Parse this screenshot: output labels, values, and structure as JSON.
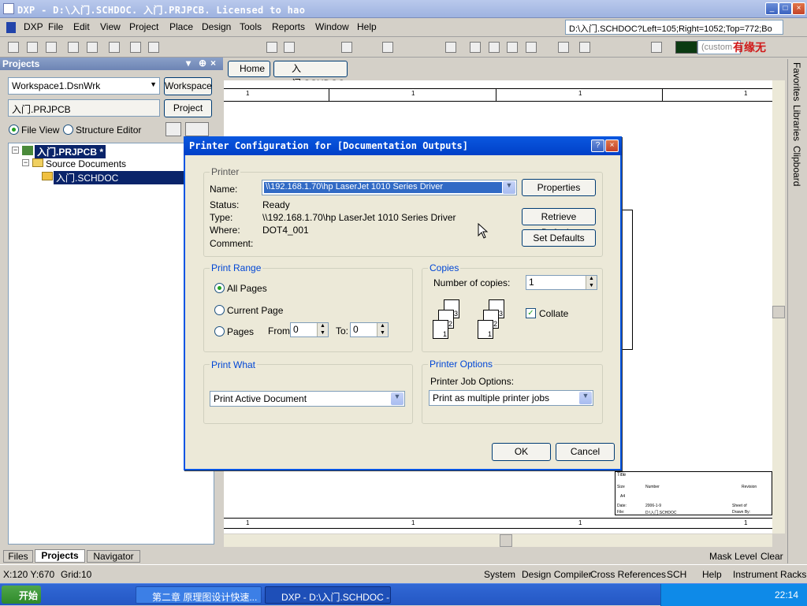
{
  "window": {
    "title": "DXP - D:\\入门.SCHDOC. 入门.PRJPCB. Licensed to hao",
    "controls": [
      "_",
      "□",
      "×"
    ]
  },
  "menu": [
    "DXP",
    "File",
    "Edit",
    "View",
    "Project",
    "Place",
    "Design",
    "Tools",
    "Reports",
    "Window",
    "Help"
  ],
  "address_combo": "D:\\入门.SCHDOC?Left=105;Right=1052;Top=772;Bo",
  "custom_combo": "(custom",
  "logo_text": "有缘无",
  "projects_panel": {
    "title": "Projects",
    "workspace_field": "Workspace1.DsnWrk",
    "workspace_button": "Workspace",
    "project_field": "入门.PRJPCB",
    "project_button": "Project",
    "file_view": "File View",
    "structure_editor": "Structure Editor",
    "tree": {
      "project": "入门.PRJPCB *",
      "folder": "Source Documents",
      "document": "入门.SCHDOC"
    },
    "tabs": [
      "Files",
      "Projects",
      "Navigator"
    ]
  },
  "doc_tabs": [
    "Home",
    "入门.SCHDOC"
  ],
  "right_panels": [
    "Favorites",
    "Libraries",
    "Clipboard"
  ],
  "ruler_marks": [
    "1",
    "1",
    "1",
    "1",
    "1",
    "1",
    "1",
    "1"
  ],
  "title_block": {
    "title": "Title",
    "size": "Size",
    "number": "Number",
    "rev": "Revision",
    "size_val": "A4",
    "date_label": "Date:",
    "date_val": "2006-1-9",
    "sheet": "Sheet   of",
    "file_label": "File:",
    "file_val": "D:\\入门.SCHDOC",
    "drawn": "Drawn By:"
  },
  "dialog": {
    "title": "Printer Configuration for [Documentation Outputs]",
    "printer_group": "Printer",
    "name_label": "Name:",
    "name_value": "\\\\192.168.1.70\\hp LaserJet 1010 Series Driver",
    "status_label": "Status:",
    "status_value": "Ready",
    "type_label": "Type:",
    "type_value": "\\\\192.168.1.70\\hp LaserJet 1010 Series Driver",
    "where_label": "Where:",
    "where_value": "DOT4_001",
    "comment_label": "Comment:",
    "properties_btn": "Properties",
    "retrieve_btn": "Retrieve Defaults",
    "setdefaults_btn": "Set Defaults",
    "range_group": "Print Range",
    "all_pages": "All Pages",
    "current_page": "Current Page",
    "pages": "Pages",
    "from_label": "From:",
    "from_value": "0",
    "to_label": "To:",
    "to_value": "0",
    "copies_group": "Copies",
    "num_copies_label": "Number of copies:",
    "num_copies_value": "1",
    "collate": "Collate",
    "page_labels": [
      "3",
      "2",
      "1",
      "3",
      "2",
      "1"
    ],
    "what_group": "Print What",
    "what_value": "Print Active Document",
    "options_group": "Printer Options",
    "job_options_label": "Printer Job Options:",
    "job_options_value": "Print as multiple printer jobs",
    "ok": "OK",
    "cancel": "Cancel"
  },
  "doc_bottom": {
    "mask_level": "Mask Level",
    "clear": "Clear"
  },
  "status": {
    "coords": "X:120 Y:670",
    "grid": "Grid:10",
    "items": [
      "System",
      "Design Compiler",
      "Cross References",
      "SCH",
      "Help",
      "Instrument Racks"
    ]
  },
  "taskbar": {
    "start": "开始",
    "tasks": [
      "第二章 原理图设计快速...",
      "DXP - D:\\入门.SCHDOC - ..."
    ],
    "clock": "22:14"
  }
}
